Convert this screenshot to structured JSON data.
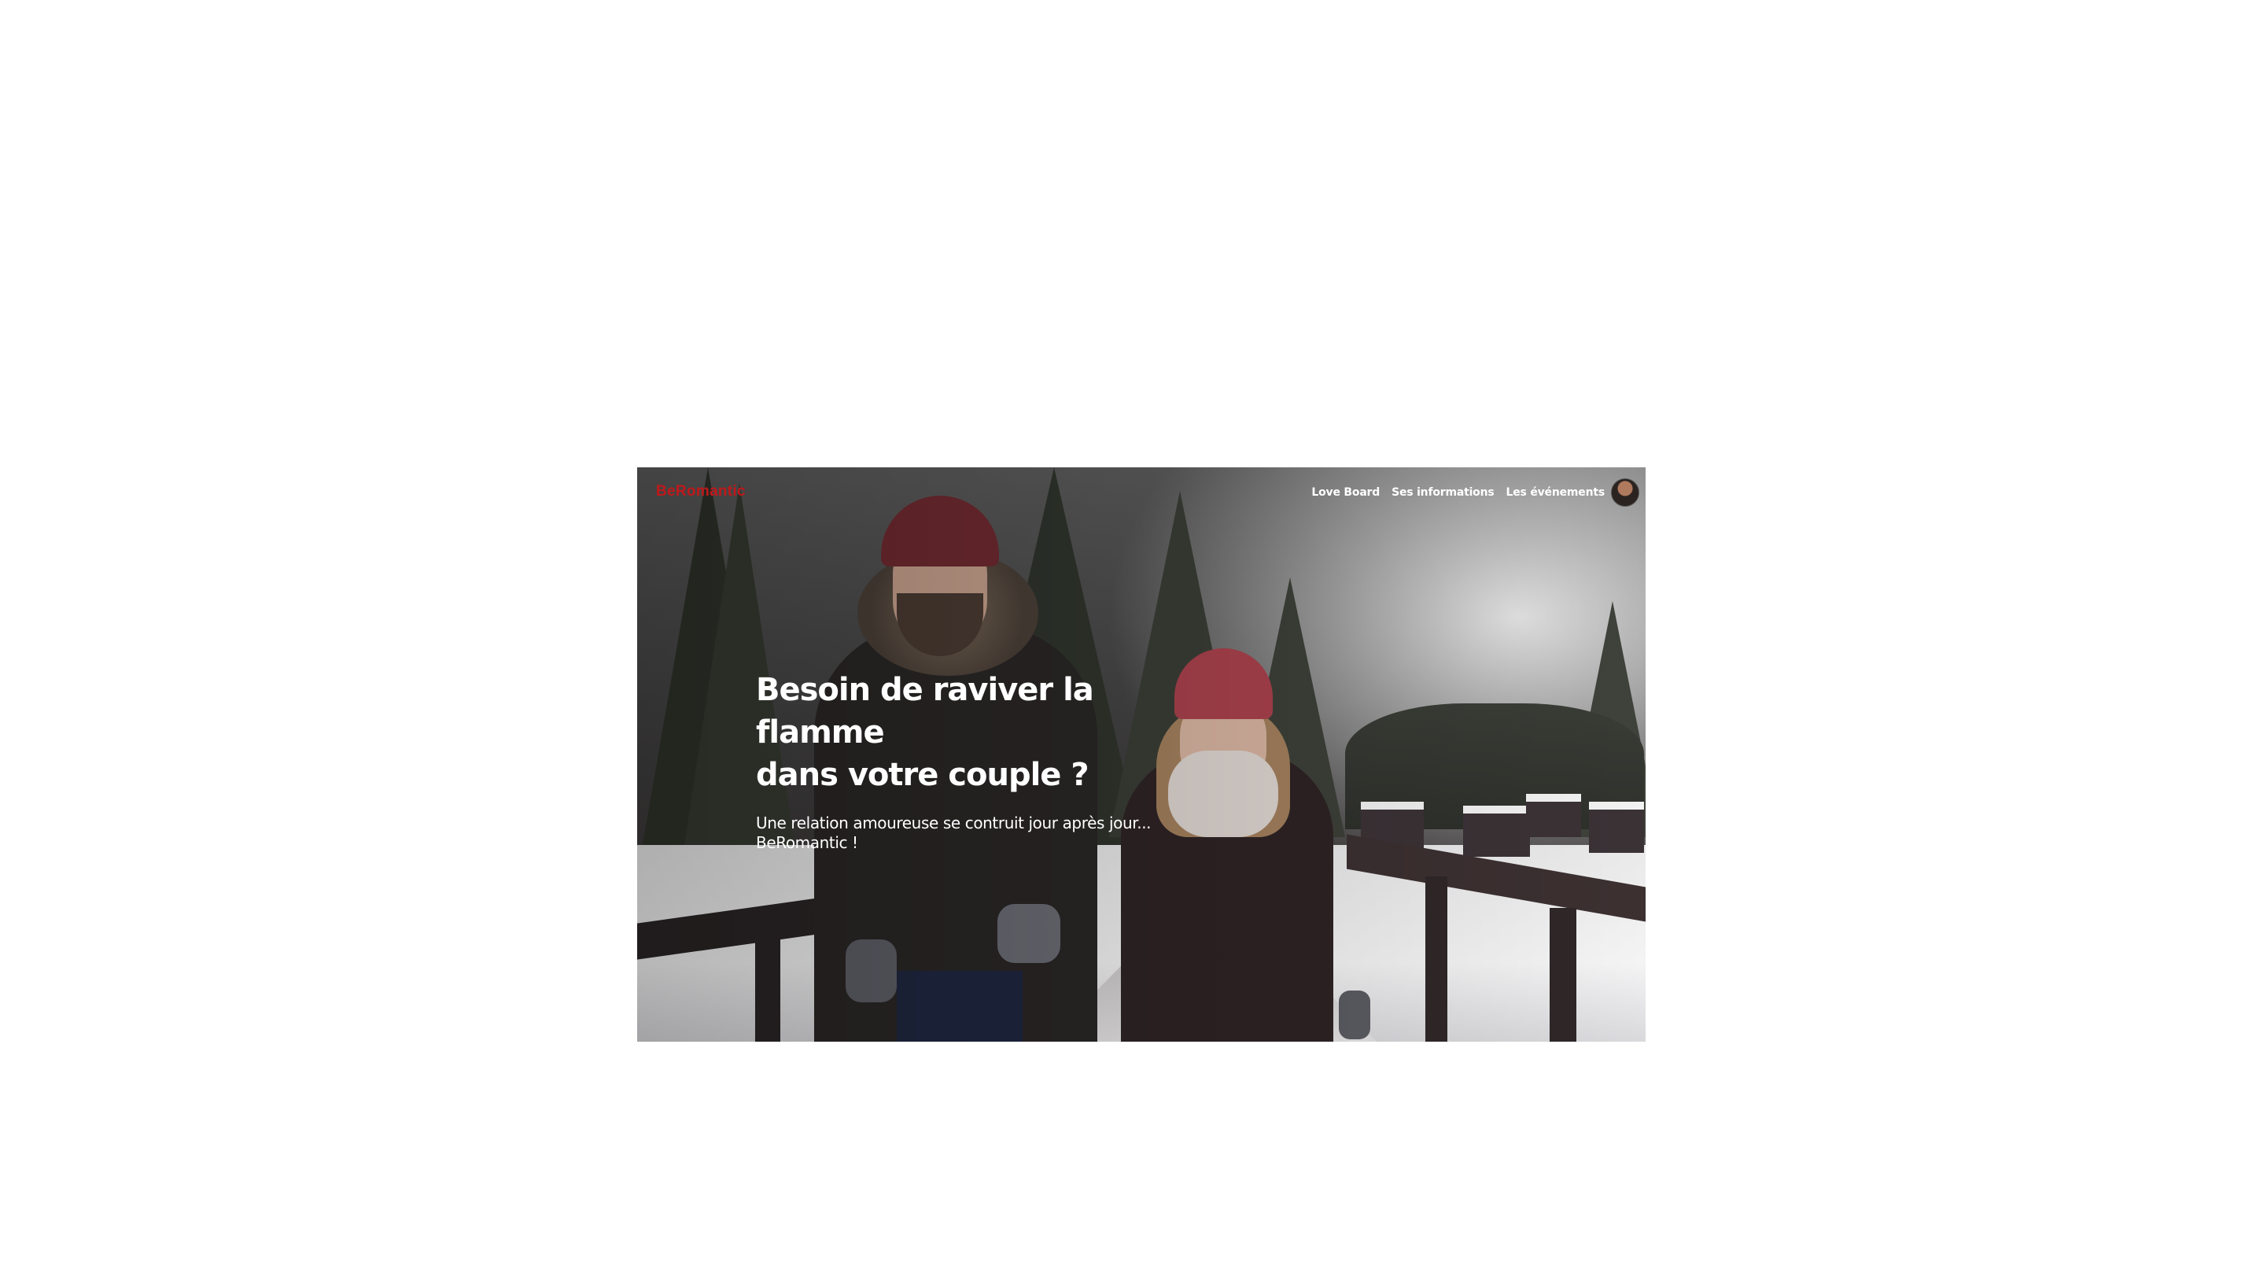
{
  "nav": {
    "logo": "BeRomantic",
    "links": [
      "Love Board",
      "Ses informations",
      "Les événements"
    ],
    "avatar_icon": "user-avatar-icon"
  },
  "hero": {
    "title_line1": "Besoin de raviver la flamme",
    "title_line2": "dans votre couple ?",
    "subtitle_line1": "Une relation amoureuse se contruit jour après jour...",
    "subtitle_line2": "BeRomantic !"
  },
  "colors": {
    "brand": "#c0181b",
    "text_on_image": "#ffffff",
    "page_background": "#ffffff"
  }
}
